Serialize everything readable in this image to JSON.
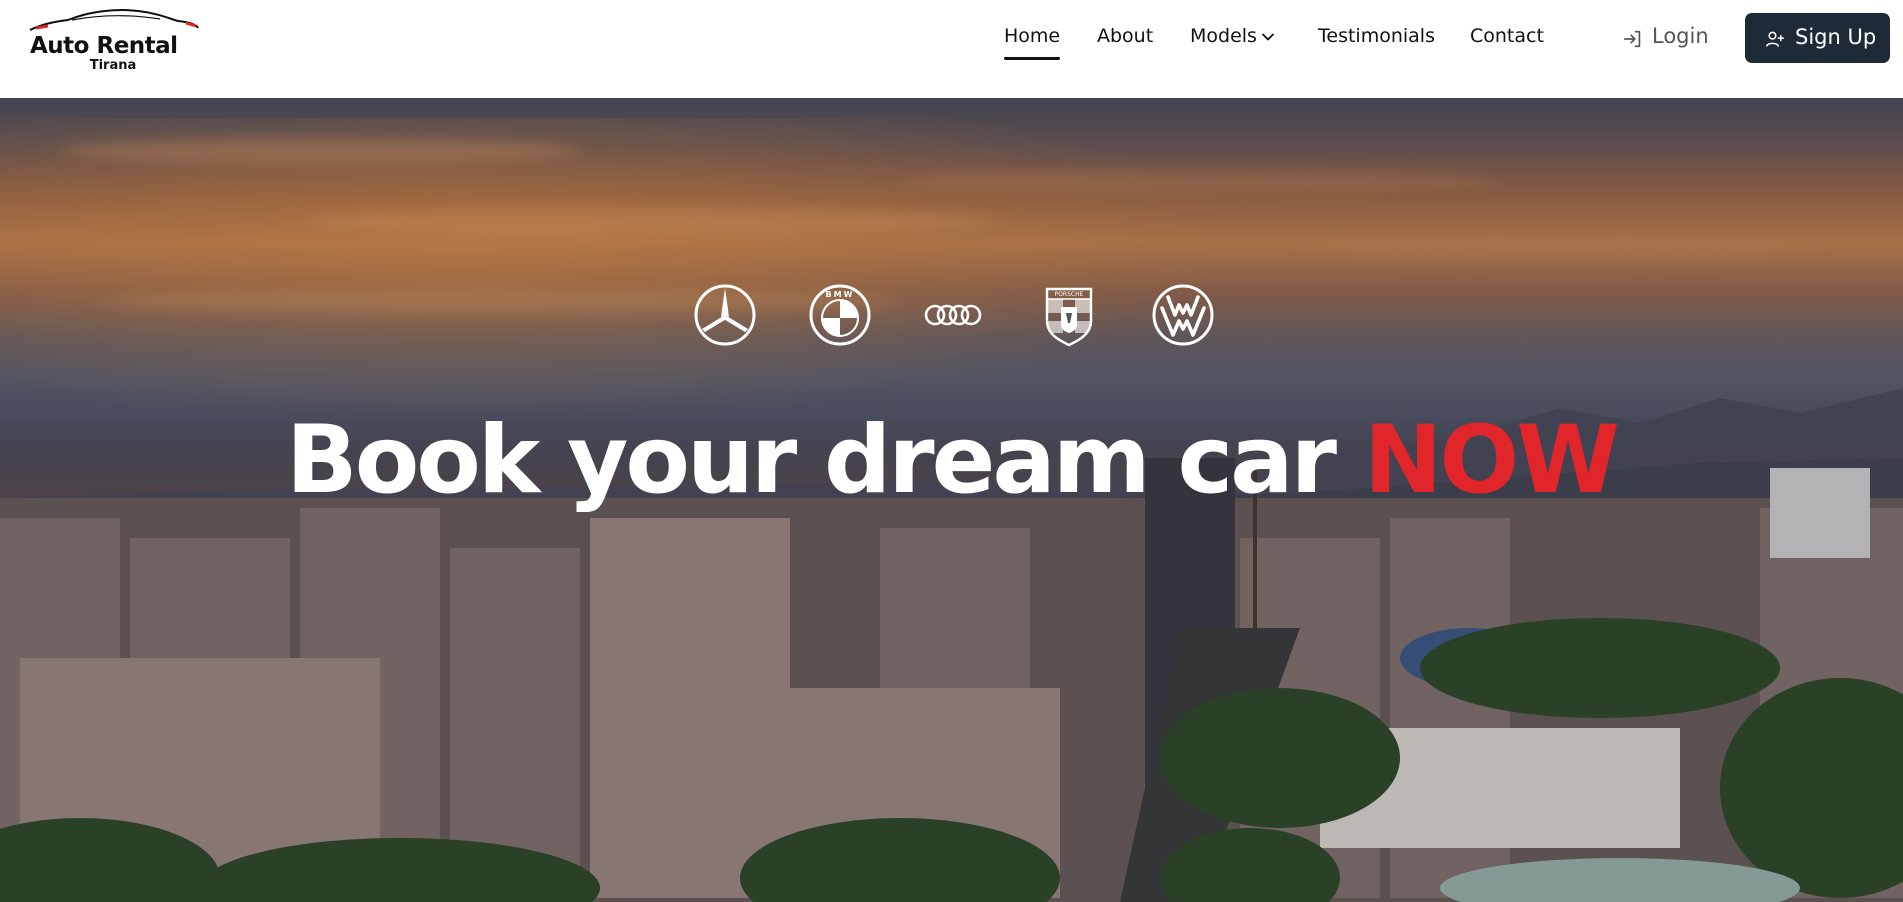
{
  "brand": {
    "title": "Auto Rental",
    "subtitle": "Tirana"
  },
  "nav": {
    "items": [
      {
        "label": "Home",
        "active": true
      },
      {
        "label": "About",
        "active": false
      },
      {
        "label": "Models",
        "active": false,
        "has_dropdown": true
      },
      {
        "label": "Testimonials",
        "active": false
      },
      {
        "label": "Contact",
        "active": false
      }
    ],
    "login_label": "Login",
    "signup_label": "Sign Up"
  },
  "hero": {
    "brand_logos": [
      "mercedes-benz-logo",
      "bmw-logo",
      "audi-logo",
      "porsche-logo",
      "volkswagen-logo"
    ],
    "bmw_letters": "BMW",
    "porsche_letters": "PORSCHE",
    "headline_main": "Book your dream car ",
    "headline_accent": "NOW"
  },
  "colors": {
    "accent": "#e1262b",
    "button_bg": "#1e2a38",
    "header_bg": "#ffffff",
    "nav_text": "#111111"
  }
}
